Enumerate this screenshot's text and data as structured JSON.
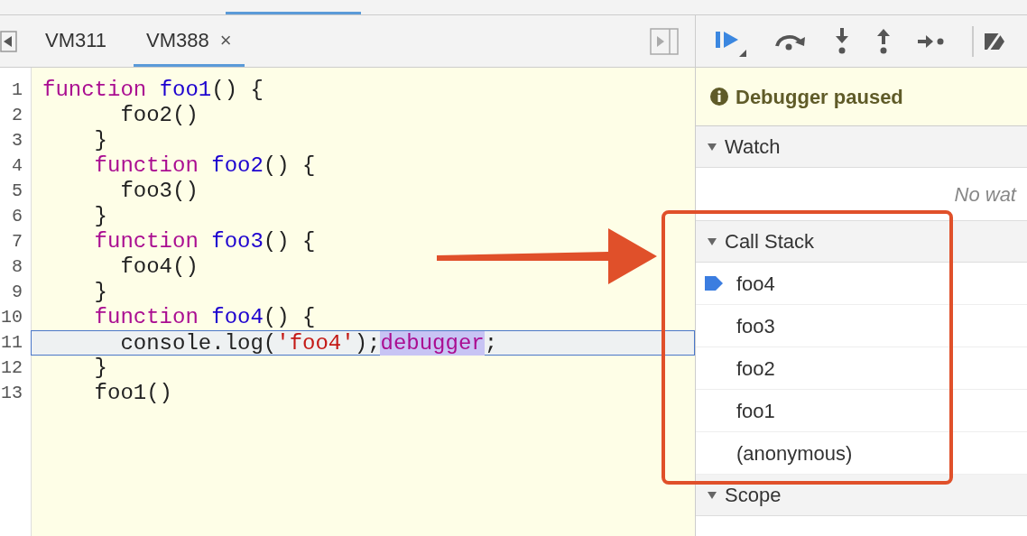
{
  "tabs": [
    {
      "label": "VM311",
      "selected": false
    },
    {
      "label": "VM388",
      "selected": true,
      "close": "×"
    }
  ],
  "code": {
    "lines": [
      {
        "number": "1",
        "current": false,
        "tokens": [
          {
            "kind": "keyword",
            "text": "function "
          },
          {
            "kind": "def",
            "text": "foo1"
          },
          {
            "kind": "plain",
            "text": "() {"
          }
        ]
      },
      {
        "number": "2",
        "current": false,
        "tokens": [
          {
            "kind": "plain",
            "text": "      foo2()"
          }
        ]
      },
      {
        "number": "3",
        "current": false,
        "tokens": [
          {
            "kind": "plain",
            "text": "    }"
          }
        ]
      },
      {
        "number": "4",
        "current": false,
        "tokens": [
          {
            "kind": "keyword",
            "text": "    function "
          },
          {
            "kind": "def",
            "text": "foo2"
          },
          {
            "kind": "plain",
            "text": "() {"
          }
        ]
      },
      {
        "number": "5",
        "current": false,
        "tokens": [
          {
            "kind": "plain",
            "text": "      foo3()"
          }
        ]
      },
      {
        "number": "6",
        "current": false,
        "tokens": [
          {
            "kind": "plain",
            "text": "    }"
          }
        ]
      },
      {
        "number": "7",
        "current": false,
        "tokens": [
          {
            "kind": "keyword",
            "text": "    function "
          },
          {
            "kind": "def",
            "text": "foo3"
          },
          {
            "kind": "plain",
            "text": "() {"
          }
        ]
      },
      {
        "number": "8",
        "current": false,
        "tokens": [
          {
            "kind": "plain",
            "text": "      foo4()"
          }
        ]
      },
      {
        "number": "9",
        "current": false,
        "tokens": [
          {
            "kind": "plain",
            "text": "    }"
          }
        ]
      },
      {
        "number": "10",
        "current": false,
        "tokens": [
          {
            "kind": "keyword",
            "text": "    function "
          },
          {
            "kind": "def",
            "text": "foo4"
          },
          {
            "kind": "plain",
            "text": "() {"
          }
        ]
      },
      {
        "number": "11",
        "current": true,
        "tokens": [
          {
            "kind": "plain",
            "text": "      console.log("
          },
          {
            "kind": "string",
            "text": "'foo4'"
          },
          {
            "kind": "plain",
            "text": ");"
          },
          {
            "kind": "selected",
            "text": "debugger"
          },
          {
            "kind": "plain",
            "text": ";"
          }
        ]
      },
      {
        "number": "12",
        "current": false,
        "tokens": [
          {
            "kind": "plain",
            "text": "    }"
          }
        ]
      },
      {
        "number": "13",
        "current": false,
        "tokens": [
          {
            "kind": "plain",
            "text": "    foo1()"
          }
        ]
      }
    ]
  },
  "status": {
    "text": "Debugger paused"
  },
  "sections": [
    {
      "title": "Watch",
      "expanded": true,
      "empty_text": "No wat"
    },
    {
      "title": "Call Stack",
      "expanded": true,
      "frames": [
        {
          "name": "foo4",
          "selected": true
        },
        {
          "name": "foo3",
          "selected": false
        },
        {
          "name": "foo2",
          "selected": false
        },
        {
          "name": "foo1",
          "selected": false
        },
        {
          "name": "(anonymous)",
          "selected": false
        }
      ]
    },
    {
      "title": "Scope",
      "expanded": true
    }
  ]
}
